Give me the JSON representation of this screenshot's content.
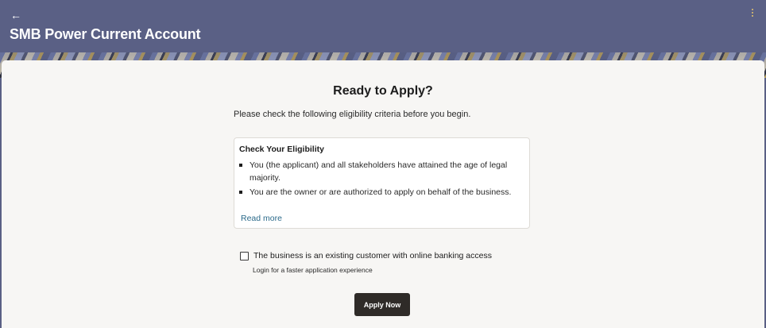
{
  "header": {
    "back_icon": "arrow-left-icon",
    "back_glyph": "←",
    "title": "SMB Power Current Account",
    "menu_icon": "kebab-menu-icon"
  },
  "colors": {
    "header_bg": "#5a6085",
    "card_bg": "#f7f6f4",
    "button_bg": "#2f2b28",
    "link": "#2b6a8a",
    "menu_dots": "#e7c46a"
  },
  "main": {
    "heading": "Ready to Apply?",
    "subtext": "Please check the following eligibility criteria before you begin.",
    "eligibility": {
      "title": "Check Your Eligibility",
      "items": [
        "You (the applicant) and all stakeholders have attained the age of legal majority.",
        "You are the owner or are authorized to apply on behalf of the business."
      ],
      "read_more": "Read more"
    },
    "existing_customer": {
      "checked": false,
      "label": "The business is an existing customer with online banking access",
      "hint": "Login for a faster application experience"
    },
    "apply_button": "Apply Now"
  }
}
